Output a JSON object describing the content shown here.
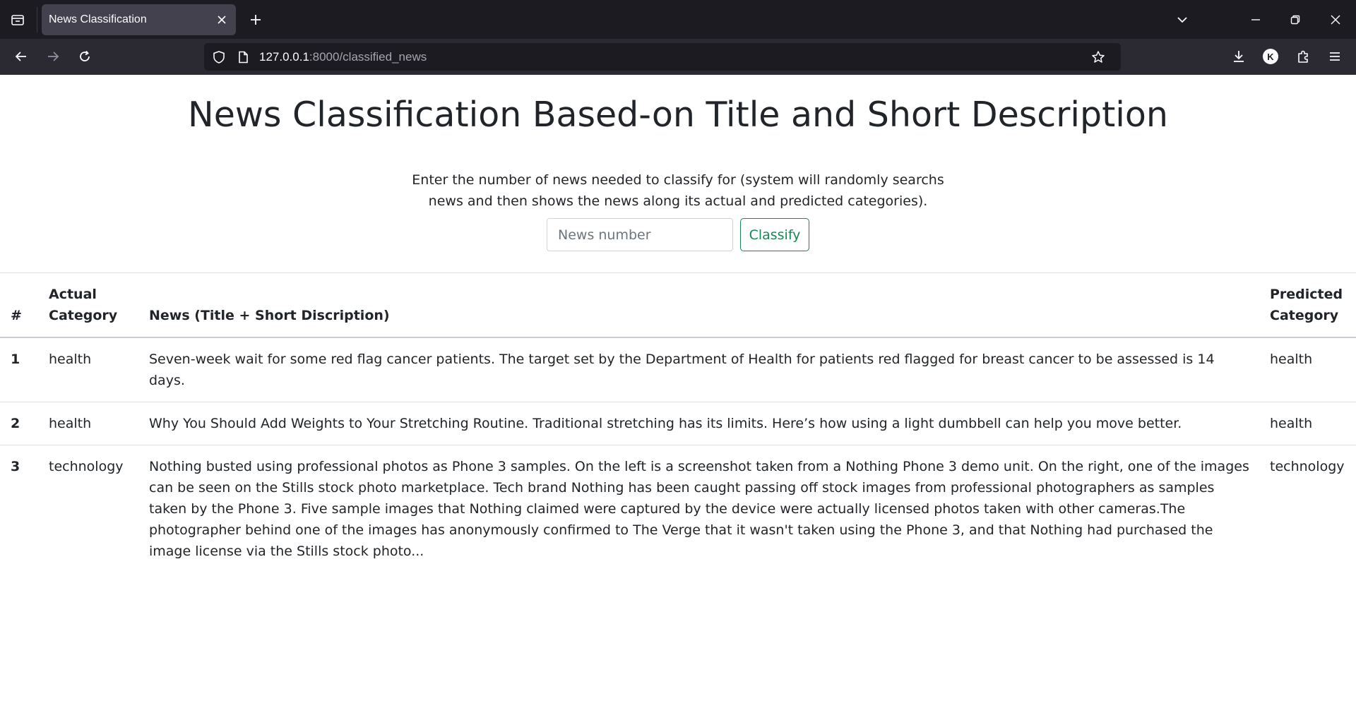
{
  "browser": {
    "tab_title": "News Classification",
    "url_host": "127.0.0.1",
    "url_path": ":8000/classified_news",
    "profile_initial": "K"
  },
  "page": {
    "title": "News Classification Based-on Title and Short Description",
    "instructions": "Enter the number of news needed to classify for (system will randomly searchs news and then shows the news along its actual and predicted categories).",
    "input_placeholder": "News number",
    "input_value": "",
    "classify_label": "Classify"
  },
  "table": {
    "headers": {
      "num": "#",
      "actual": "Actual Category",
      "news": "News (Title + Short Discription)",
      "predicted": "Predicted Category"
    },
    "rows": [
      {
        "num": "1",
        "actual": "health",
        "news": "Seven-week wait for some red flag cancer patients. The target set by the Department of Health for patients red flagged for breast cancer to be assessed is 14 days.",
        "predicted": "health"
      },
      {
        "num": "2",
        "actual": "health",
        "news": "Why You Should Add Weights to Your Stretching Routine. Traditional stretching has its limits. Here’s how using a light dumbbell can help you move better.",
        "predicted": "health"
      },
      {
        "num": "3",
        "actual": "technology",
        "news": "Nothing busted using professional photos as Phone 3 samples. On the left is a screenshot taken from a Nothing Phone 3 demo unit. On the right, one of the images can be seen on the Stills stock photo marketplace. Tech brand Nothing has been caught passing off stock images from professional photographers as samples taken by the Phone 3. Five sample images that Nothing claimed were captured by the device were actually licensed photos taken with other cameras.The photographer behind one of the images has anonymously confirmed to The Verge that it wasn't taken using the Phone 3, and that Nothing had purchased the image license via the Stills stock photo...",
        "predicted": "technology"
      }
    ]
  },
  "colors": {
    "tabbar_bg": "#1c1b22",
    "navbar_bg": "#2b2a33",
    "active_tab_bg": "#42414d",
    "accent_green": "#198754",
    "text": "#212529"
  },
  "icons": {
    "tab_list": "tab-list-icon",
    "new_tab": "plus-icon",
    "back": "arrow-left-icon",
    "forward": "arrow-right-icon",
    "reload": "reload-icon",
    "shield": "shield-icon",
    "page": "page-icon",
    "bookmark": "star-icon",
    "download": "download-icon",
    "extensions": "puzzle-icon",
    "menu": "hamburger-menu-icon"
  }
}
